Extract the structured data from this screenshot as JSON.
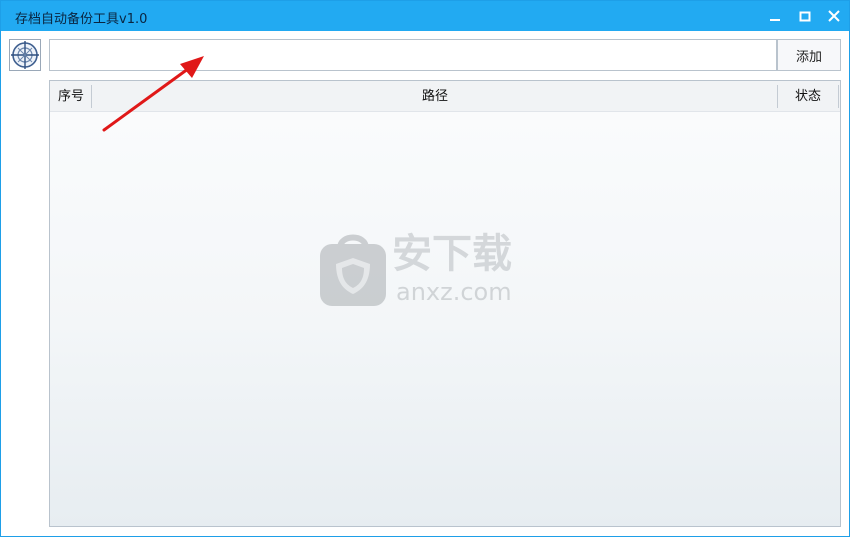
{
  "window": {
    "title": "存档自动备份工具v1.0",
    "titlebar_color": "#22aaf2",
    "controls": [
      "minimize-icon",
      "maximize-icon",
      "close-icon"
    ]
  },
  "toolbar": {
    "app_icon": "crosshair-icon",
    "path_input_value": "",
    "add_label": "添加"
  },
  "list": {
    "columns": [
      "序号",
      "路径",
      "状态"
    ],
    "rows": []
  },
  "watermark": {
    "icon": "shield-bag-icon",
    "text_cn": "安下载",
    "text_en": "anxz.com"
  },
  "annotation": {
    "icon": "red-arrow-icon",
    "color": "#e01818"
  }
}
